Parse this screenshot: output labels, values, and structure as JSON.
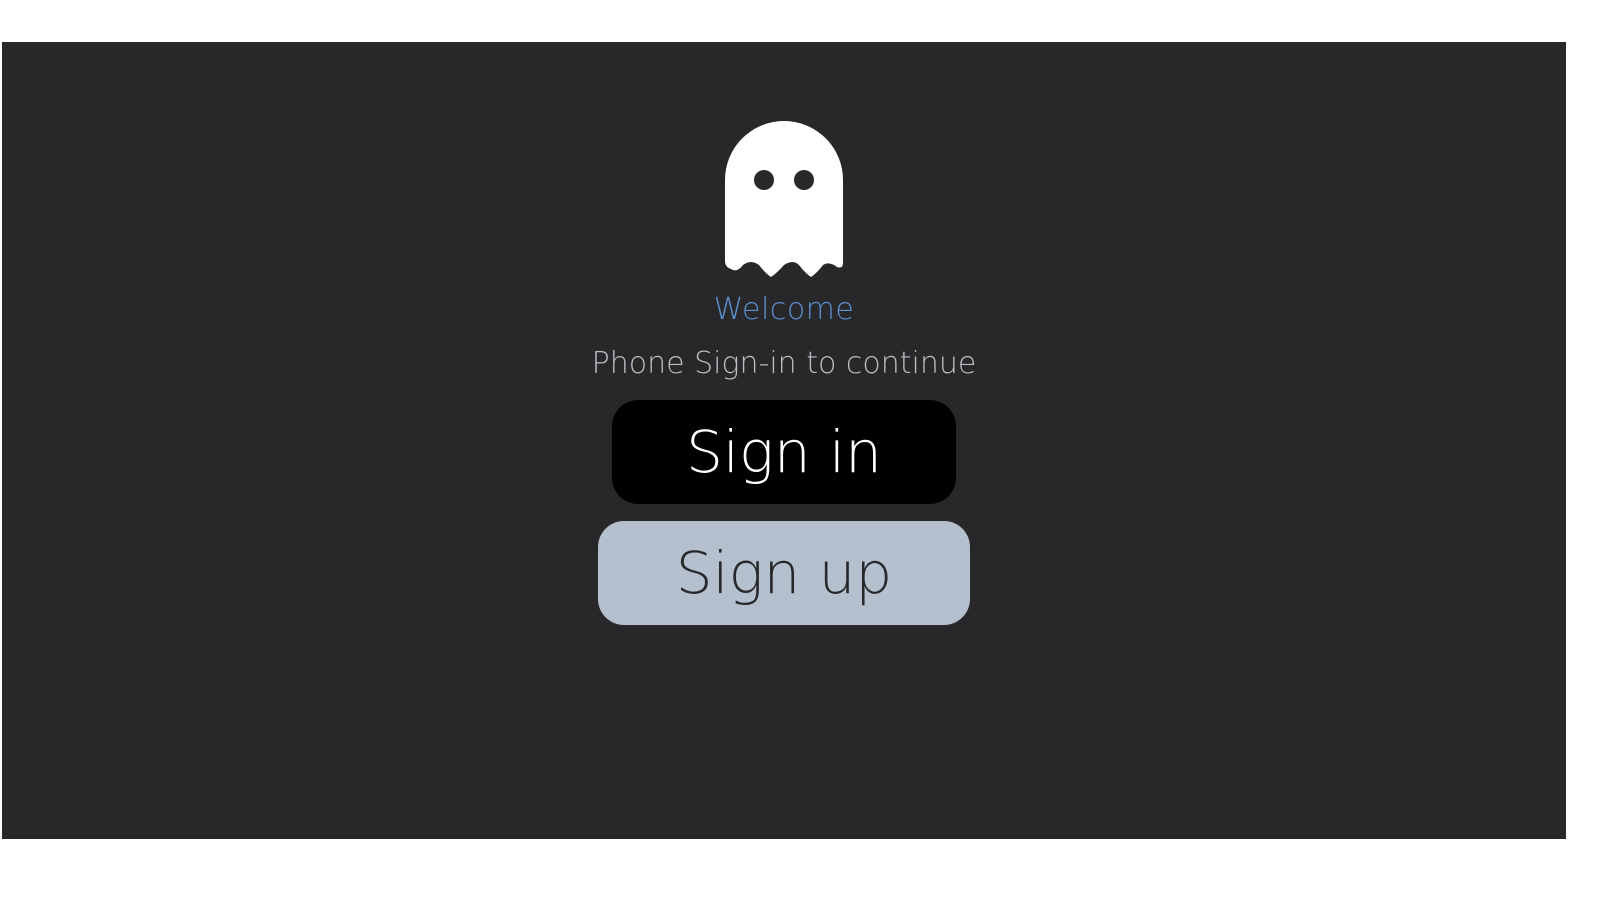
{
  "screen": {
    "background_color": "#28282a",
    "accent_color": "#5a8fd0"
  },
  "logo": {
    "icon": "ghost-icon"
  },
  "welcome_text": "Welcome",
  "subtitle_text": "Phone Sign-in to continue",
  "buttons": {
    "sign_in": {
      "label": "Sign in",
      "background": "#000000",
      "text_color": "#ffffff"
    },
    "sign_up": {
      "label": "Sign up",
      "background": "#b4c0ce",
      "text_color": "#28282a"
    }
  }
}
